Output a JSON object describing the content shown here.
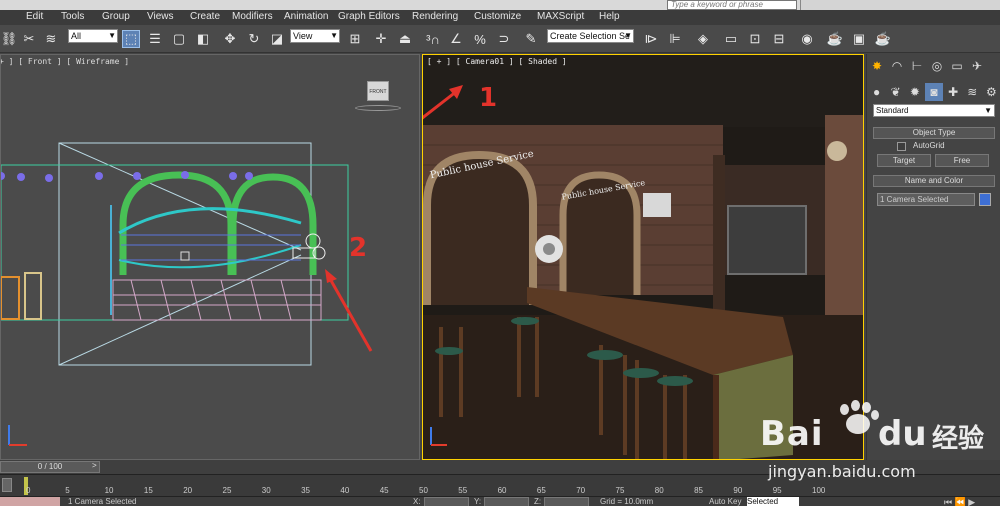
{
  "menu": {
    "items": [
      "Edit",
      "Tools",
      "Group",
      "Views",
      "Create",
      "Modifiers",
      "Animation",
      "Graph Editors",
      "Rendering",
      "Customize",
      "MAXScript",
      "Help"
    ],
    "search_placeholder": "Type a keyword or phrase"
  },
  "toolbar": {
    "selection_filter": "All",
    "ref_coord": "View",
    "named_selection": "Create Selection Se"
  },
  "viewports": {
    "left_label": "+ ] [ Front ] [ Wireframe ]",
    "right_label": "[ + ] [ Camera01 ] [ Shaded ]",
    "viewcube_label": "FRONT",
    "sign_left": "Public house Service",
    "sign_right": "Public house Service"
  },
  "annotations": {
    "one": "1",
    "two": "2",
    "color": "#e3332b"
  },
  "command_panel": {
    "dropdown": "Standard",
    "object_type_title": "Object Type",
    "autogrid_label": "AutoGrid",
    "target_button": "Target",
    "free_button": "Free",
    "name_color_title": "Name and Color",
    "name_field": "1 Camera Selected",
    "swatch_color": "#3e6fd4"
  },
  "timeline": {
    "slider_text": "0 / 100",
    "ticks": [
      "0",
      "5",
      "10",
      "15",
      "20",
      "25",
      "30",
      "35",
      "40",
      "45",
      "50",
      "55",
      "60",
      "65",
      "70",
      "75",
      "80",
      "85",
      "90",
      "95",
      "100"
    ]
  },
  "status": {
    "selection_text": "1 Camera Selected",
    "x_label": "X:",
    "y_label": "Y:",
    "z_label": "Z:",
    "grid_text": "Grid = 10.0mm",
    "autokey_label": "Auto Key",
    "selected_dropdown": "Selected"
  },
  "watermark": {
    "brand": "Bai",
    "brand_suffix": "经验",
    "url": "jingyan.baidu.com"
  }
}
